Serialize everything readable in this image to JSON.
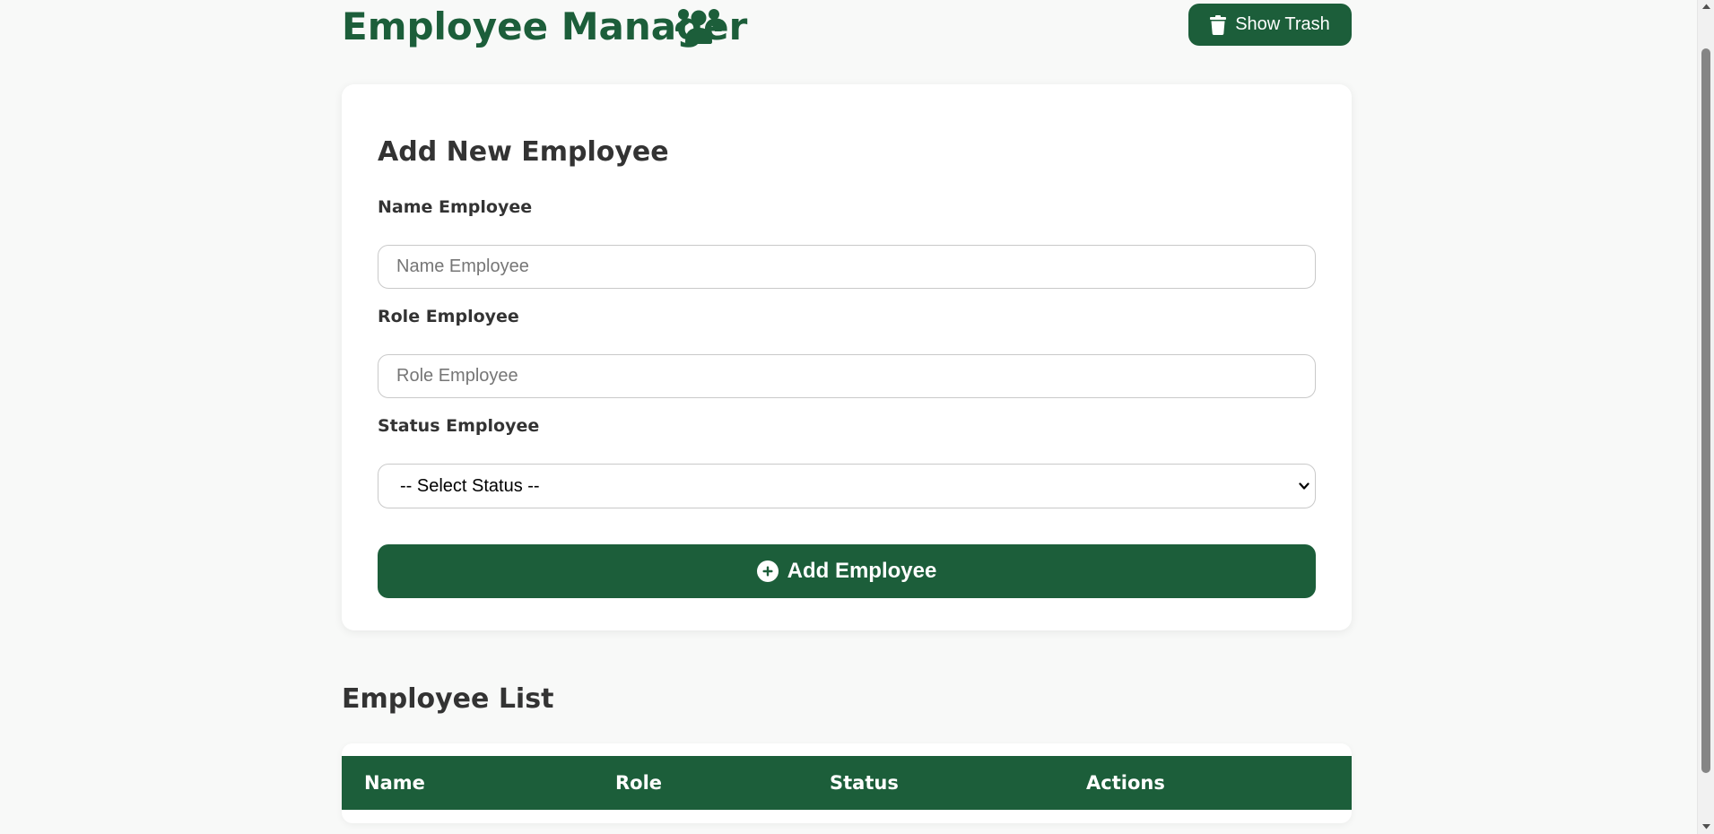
{
  "header": {
    "title": "Employee Manager",
    "title_icon": "users-icon",
    "trash_button_label": "Show Trash",
    "trash_icon": "trash-icon"
  },
  "form": {
    "title": "Add New Employee",
    "name_label": "Name Employee",
    "name_placeholder": "Name Employee",
    "name_value": "",
    "role_label": "Role Employee",
    "role_placeholder": "Role Employee",
    "role_value": "",
    "status_label": "Status Employee",
    "status_selected": "-- Select Status --",
    "submit_label": "Add Employee",
    "submit_icon": "plus-circle-icon"
  },
  "list": {
    "title": "Employee List",
    "columns": [
      "Name",
      "Role",
      "Status",
      "Actions"
    ]
  },
  "colors": {
    "brand_green": "#1c5e3a",
    "background": "#f8f9f8",
    "card": "#ffffff",
    "text": "#333333"
  }
}
